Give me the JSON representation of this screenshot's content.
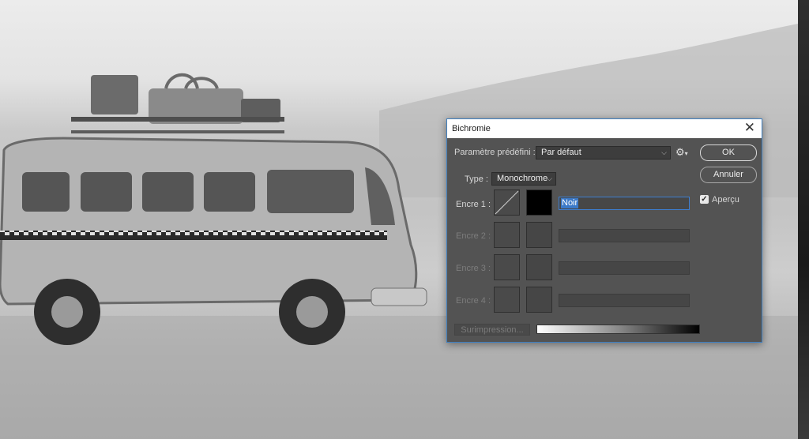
{
  "dialog": {
    "title": "Bichromie",
    "close_icon": "close-icon",
    "preset": {
      "label": "Paramètre prédéfini :",
      "value": "Par défaut"
    },
    "settings_icon": "gear-icon",
    "type": {
      "label": "Type :",
      "value": "Monochrome"
    },
    "buttons": {
      "ok": "OK",
      "cancel": "Annuler"
    },
    "preview": {
      "label": "Aperçu",
      "checked": true
    },
    "inks": [
      {
        "label": "Encre 1 :",
        "name": "Noir",
        "color": "#000000",
        "enabled": true
      },
      {
        "label": "Encre 2 :",
        "name": "",
        "color": "",
        "enabled": false
      },
      {
        "label": "Encre 3 :",
        "name": "",
        "color": "",
        "enabled": false
      },
      {
        "label": "Encre 4 :",
        "name": "",
        "color": "",
        "enabled": false
      }
    ],
    "overprint_button": "Surimpression..."
  },
  "colors": {
    "accent": "#3b79c8",
    "dialog_bg": "#535353"
  }
}
